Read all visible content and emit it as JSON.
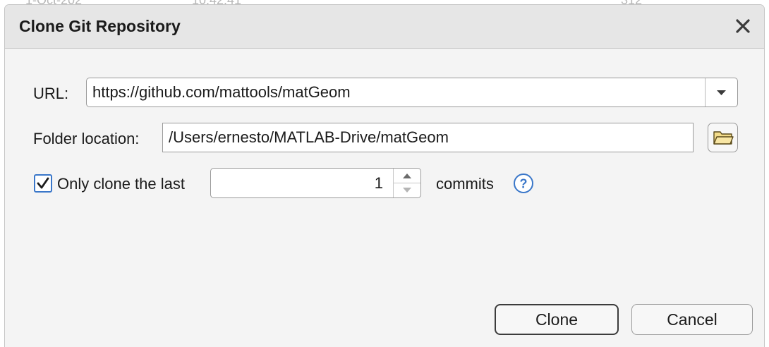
{
  "background": {
    "fragments": [
      "1-Oct-202",
      "10:42:41",
      "",
      "312"
    ]
  },
  "dialog": {
    "title": "Clone Git Repository",
    "close_icon": "close-icon"
  },
  "url": {
    "label": "URL:",
    "value": "https://github.com/mattools/matGeom",
    "dropdown_icon": "chevron-down-icon"
  },
  "folder": {
    "label": "Folder location:",
    "value": "/Users/ernesto/MATLAB-Drive/matGeom",
    "browse_icon": "folder-icon"
  },
  "shallow_clone": {
    "checked": true,
    "label": "Only clone the last",
    "count": "1",
    "suffix": "commits",
    "help_icon": "help-icon"
  },
  "buttons": {
    "clone": "Clone",
    "cancel": "Cancel"
  },
  "colors": {
    "accent": "#3a77c9",
    "dialog_bg": "#f4f4f4",
    "titlebar_bg": "#e6e6e6",
    "folder_icon": "#f3dc8a"
  }
}
